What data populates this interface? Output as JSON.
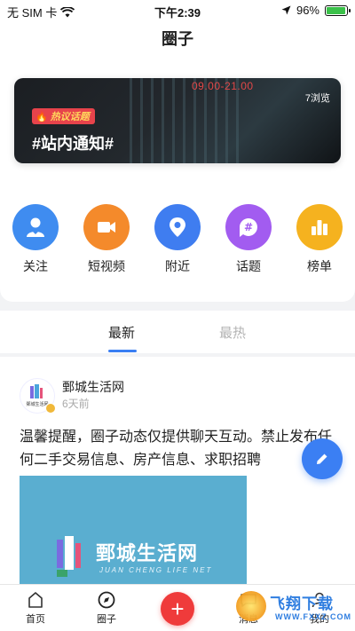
{
  "status_bar": {
    "carrier": "无 SIM 卡",
    "time": "下午2:39",
    "battery_percent": "96%",
    "battery_level": 0.96
  },
  "header": {
    "title": "圈子"
  },
  "banner": {
    "views": "7浏览",
    "tag": "热议话题",
    "title": "#站内通知#",
    "sign_text": "09.00-21.00"
  },
  "categories": [
    {
      "label": "关注",
      "icon": "user-heart-icon",
      "color": "#3f8cf0"
    },
    {
      "label": "短视频",
      "icon": "video-icon",
      "color": "#f48a2b"
    },
    {
      "label": "附近",
      "icon": "location-pin-icon",
      "color": "#3f7df0"
    },
    {
      "label": "话题",
      "icon": "hashtag-icon",
      "color": "#a25cf0"
    },
    {
      "label": "榜单",
      "icon": "ranking-icon",
      "color": "#f5b21f"
    }
  ],
  "tabs": {
    "latest": "最新",
    "hottest": "最热"
  },
  "post": {
    "author": "鄄城生活网",
    "time": "6天前",
    "content": "温馨提醒，圈子动态仅提供聊天互动。禁止发布任何二手交易信息、房产信息、求职招聘",
    "image_title": "鄄城生活网",
    "image_subtitle": "JUAN CHENG LIFE NET",
    "avatar_text": "鄄城生活网"
  },
  "bottom_nav": {
    "home": "首页",
    "circle": "圈子",
    "messages": "消息",
    "mine": "我的"
  },
  "watermark": {
    "title": "飞翔下载",
    "url": "WWW.FXXZ.COM"
  }
}
